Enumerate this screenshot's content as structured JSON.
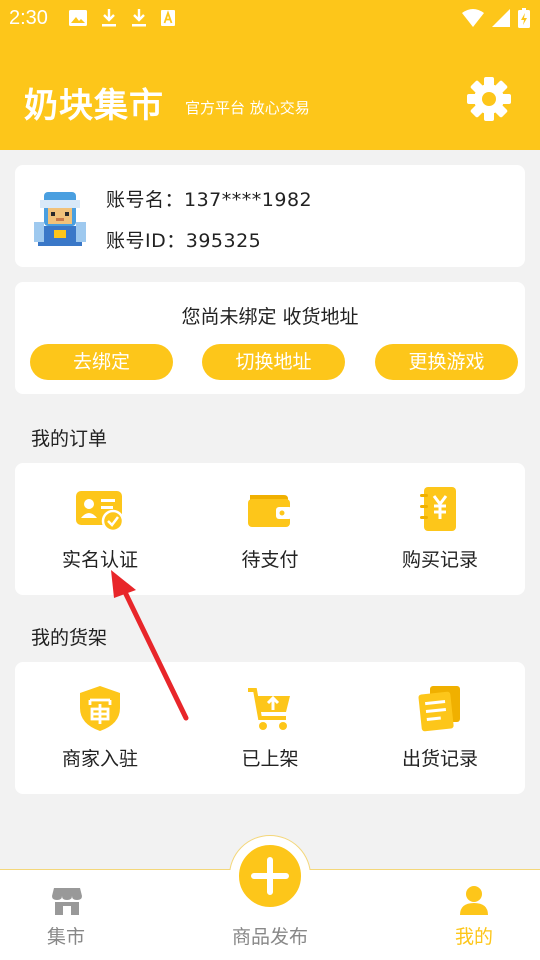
{
  "status_bar": {
    "time": "2:30",
    "left_icons": [
      "image-icon",
      "download-icon",
      "download-icon",
      "font-a-icon"
    ],
    "right_icons": [
      "wifi-icon",
      "signal-icon",
      "battery-charging-icon"
    ]
  },
  "header": {
    "title": "奶块集市",
    "slogan": "官方平台 放心交易",
    "settings_icon": "gear-icon",
    "background_color": "#fdc61a"
  },
  "account": {
    "name_line": "账号名：137****1982",
    "id_line": "账号ID：395325"
  },
  "address": {
    "message": "您尚未绑定 收货地址",
    "buttons": [
      "去绑定",
      "切换地址",
      "更换游戏"
    ]
  },
  "orders": {
    "title": "我的订单",
    "items": [
      {
        "label": "实名认证",
        "icon": "id-card-icon"
      },
      {
        "label": "待支付",
        "icon": "wallet-icon"
      },
      {
        "label": "购买记录",
        "icon": "yuan-notebook-icon"
      }
    ]
  },
  "shelf": {
    "title": "我的货架",
    "items": [
      {
        "label": "商家入驻",
        "icon": "shield-icon"
      },
      {
        "label": "已上架",
        "icon": "cart-upload-icon"
      },
      {
        "label": "出货记录",
        "icon": "document-stack-icon"
      }
    ]
  },
  "bottom_nav": {
    "items": [
      {
        "label": "集市",
        "icon": "store-icon",
        "active": false
      },
      {
        "label": "商品发布",
        "icon": "plus-icon",
        "active": false
      },
      {
        "label": "我的",
        "icon": "person-icon",
        "active": true
      }
    ],
    "active_color": "#fdc61a",
    "inactive_color": "#888888"
  },
  "annotation_color": "#e8262a"
}
